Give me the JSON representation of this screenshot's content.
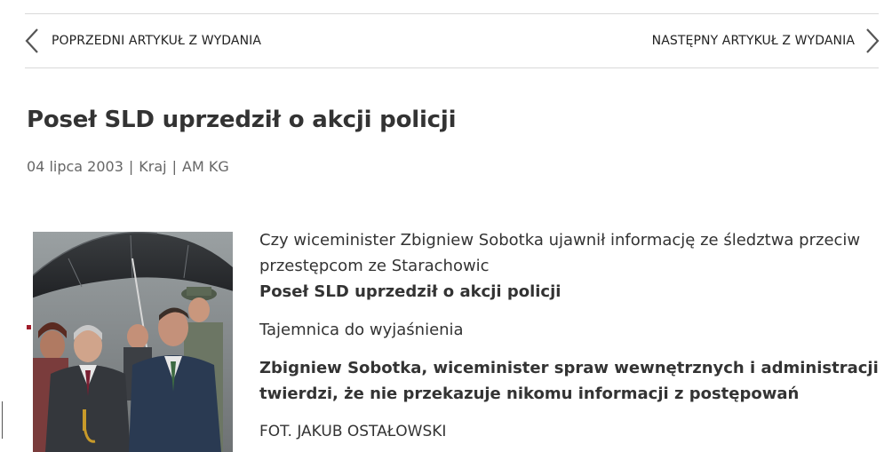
{
  "nav": {
    "prev_label": "POPRZEDNI ARTYKUŁ Z WYDANIA",
    "next_label": "NASTĘPNY ARTYKUŁ Z WYDANIA",
    "prev_icon": "chevron-left-icon",
    "next_icon": "chevron-right-icon"
  },
  "article": {
    "title": "Poseł SLD uprzedził o akcji policji",
    "date": "04 lipca 2003",
    "section": "Kraj",
    "author": "AM KG",
    "separator": "|",
    "lead_line": "Czy wiceminister Zbigniew Sobotka ujawnił informację ze śledztwa przeciw przestępcom ze Starachowic",
    "subtitle": "Poseł SLD uprzedził o akcji policji",
    "section_heading": "Tajemnica do wyjaśnienia",
    "bold_paragraph": "Zbigniew Sobotka, wiceminister spraw wewnętrznych i administracji twierdzi, że nie przekazuje nikomu informacji z postępowań",
    "photo_credit": "FOT. JAKUB OSTAŁOWSKI"
  },
  "colors": {
    "accent": "#a01d2b",
    "text": "#333333",
    "meta_text": "#666666",
    "rule": "#d9d9d9"
  }
}
